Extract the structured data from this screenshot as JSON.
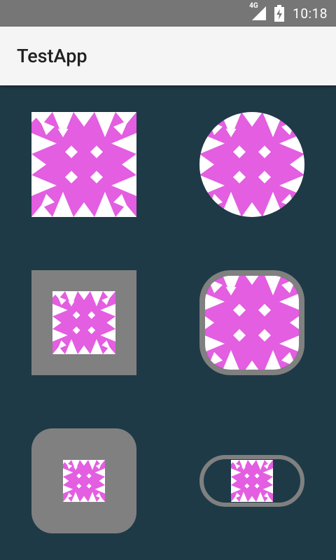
{
  "status_bar": {
    "network": "4G",
    "time": "10:18",
    "colors": {
      "background": "#767676",
      "icon": "#ffffff"
    }
  },
  "app_bar": {
    "title": "TestApp",
    "background": "#f5f5f5"
  },
  "content": {
    "background": "#1e3a46",
    "image_colors": {
      "fill": "#e35ee0",
      "accent": "#ffffff",
      "frame": "#808080"
    },
    "images": [
      {
        "name": "image-square",
        "shape": "square"
      },
      {
        "name": "image-circle",
        "shape": "circle"
      },
      {
        "name": "image-padded-square",
        "shape": "square with gray padding"
      },
      {
        "name": "image-rounded-bordered",
        "shape": "rounded square with gray border"
      },
      {
        "name": "image-rounded-padded",
        "shape": "rounded square with gray padding"
      },
      {
        "name": "image-pill-bordered",
        "shape": "pill with gray border"
      }
    ]
  }
}
